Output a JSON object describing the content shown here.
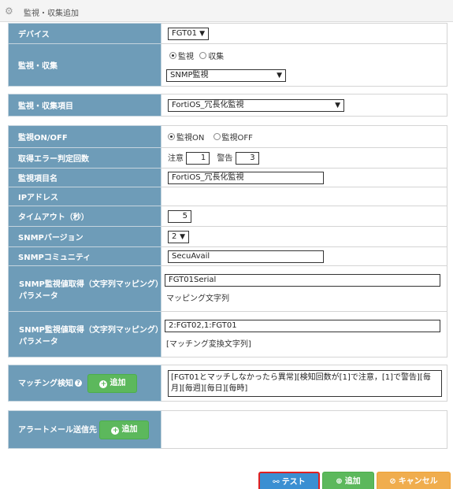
{
  "header": {
    "title": "監視・収集追加",
    "icon": "gear-icon"
  },
  "device": {
    "label": "デバイス",
    "value": "FGT01"
  },
  "monitor_collect": {
    "label": "監視・収集",
    "option_monitor": "監視",
    "option_collect": "収集",
    "type_value": "SNMP監視"
  },
  "item": {
    "label": "監視・収集項目",
    "value": "FortiOS_冗長化監視"
  },
  "onoff": {
    "label": "監視ON/OFF",
    "on_label": "監視ON",
    "off_label": "監視OFF"
  },
  "error_count": {
    "label": "取得エラー判定回数",
    "caution_label": "注意",
    "caution_value": "1",
    "warning_label": "警告",
    "warning_value": "3"
  },
  "item_name": {
    "label": "監視項目名",
    "value": "FortiOS_冗長化監視"
  },
  "ip": {
    "label": "IPアドレス",
    "value": ""
  },
  "timeout": {
    "label": "タイムアウト（秒）",
    "value": "5"
  },
  "snmp_version": {
    "label": "SNMPバージョン",
    "value": "2"
  },
  "community": {
    "label": "SNMPコミュニティ",
    "value": "SecuAvail"
  },
  "mapping1": {
    "label": "SNMP監視値取得（文字列マッピング）パラメータ",
    "value": "FGT01Serial",
    "note": "マッピング文字列"
  },
  "mapping2": {
    "label": "SNMP監視値取得（文字列マッピング）パラメータ",
    "value": "2:FGT02,1:FGT01",
    "note": "[マッチング変換文字列]"
  },
  "matching": {
    "label": "マッチング検知",
    "add_label": "追加",
    "text": "[FGT01とマッチしなかったら異常][検知回数が[1]で注意，[1]で警告][毎月][毎週][毎日][毎時]"
  },
  "alert_mail": {
    "label": "アラートメール送信先",
    "add_label": "追加"
  },
  "footer": {
    "test_label": "テスト",
    "add_label": "追加",
    "cancel_label": "キャンセル"
  },
  "colors": {
    "label_bg": "#6e9cb8",
    "test": "#3a8fd2",
    "add": "#5cb85c",
    "cancel": "#f0ad4e",
    "focus": "#e02020"
  }
}
